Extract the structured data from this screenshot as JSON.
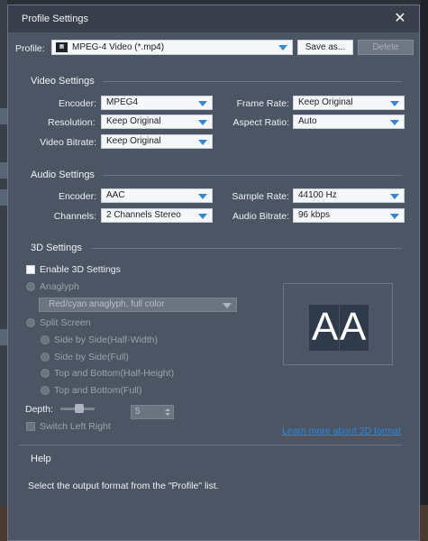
{
  "window": {
    "title": "Profile Settings"
  },
  "profile": {
    "label": "Profile:",
    "value": "MPEG-4 Video (*.mp4)",
    "save_as": "Save as...",
    "delete": "Delete"
  },
  "video": {
    "heading": "Video Settings",
    "encoder_label": "Encoder:",
    "encoder": "MPEG4",
    "resolution_label": "Resolution:",
    "resolution": "Keep Original",
    "bitrate_label": "Video Bitrate:",
    "bitrate": "Keep Original",
    "framerate_label": "Frame Rate:",
    "framerate": "Keep Original",
    "aspect_label": "Aspect Ratio:",
    "aspect": "Auto"
  },
  "audio": {
    "heading": "Audio Settings",
    "encoder_label": "Encoder:",
    "encoder": "AAC",
    "channels_label": "Channels:",
    "channels": "2 Channels Stereo",
    "samplerate_label": "Sample Rate:",
    "samplerate": "44100 Hz",
    "bitrate_label": "Audio Bitrate:",
    "bitrate": "96 kbps"
  },
  "three_d": {
    "heading": "3D Settings",
    "enable_label": "Enable 3D Settings",
    "anaglyph_label": "Anaglyph",
    "anaglyph_value": "Red/cyan anaglyph, full color",
    "split_label": "Split Screen",
    "options": [
      "Side by Side(Half-Width)",
      "Side by Side(Full)",
      "Top and Bottom(Half-Height)",
      "Top and Bottom(Full)"
    ],
    "depth_label": "Depth:",
    "depth_value": "5",
    "switch_label": "Switch Left Right",
    "learn_more": "Learn more about 3D format",
    "preview_text_left": "A",
    "preview_text_right": "A"
  },
  "help": {
    "heading": "Help",
    "text": "Select the output format from the \"Profile\" list."
  },
  "colors": {
    "accent": "#2f87d8",
    "dialog_bg": "#4c5563",
    "titlebar_bg": "#3a404b"
  }
}
